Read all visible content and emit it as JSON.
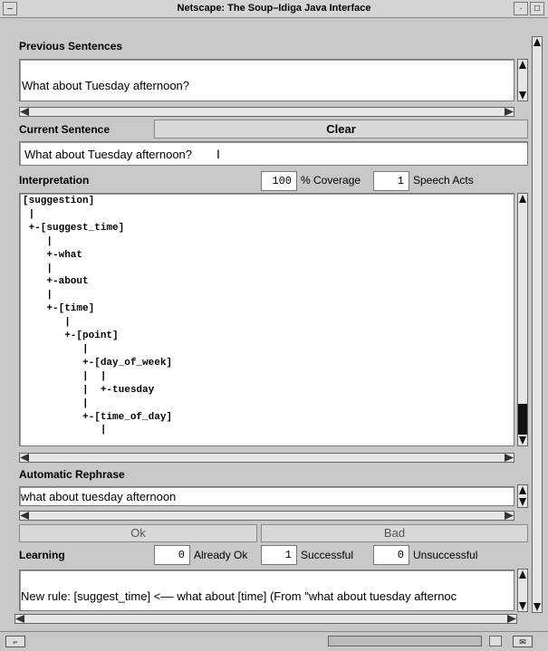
{
  "window": {
    "title": "Netscape: The Soup–Idiga Java Interface"
  },
  "previous": {
    "label": "Previous Sentences",
    "text": "What about Tuesday afternoon?"
  },
  "current": {
    "label": "Current Sentence",
    "clear_label": "Clear",
    "value": "What about Tuesday afternoon?"
  },
  "interpretation": {
    "label": "Interpretation",
    "coverage_value": "100",
    "coverage_label": "% Coverage",
    "speech_acts_value": "1",
    "speech_acts_label": "Speech Acts",
    "tree": "[suggestion]\n |\n +-[suggest_time]\n    |\n    +-what\n    |\n    +-about\n    |\n    +-[time]\n       |\n       +-[point]\n          |\n          +-[day_of_week]\n          |  |\n          |  +-tuesday\n          |\n          +-[time_of_day]\n             |"
  },
  "rephrase": {
    "label": "Automatic Rephrase",
    "value": "what about tuesday afternoon"
  },
  "buttons": {
    "ok": "Ok",
    "bad": "Bad"
  },
  "learning": {
    "label": "Learning",
    "already_ok_value": "0",
    "already_ok_label": "Already Ok",
    "successful_value": "1",
    "successful_label": "Successful",
    "unsuccessful_value": "0",
    "unsuccessful_label": "Unsuccessful",
    "message": "New rule:  [suggest_time] <–– what about [time]  (From \"what about tuesday afternoc"
  }
}
